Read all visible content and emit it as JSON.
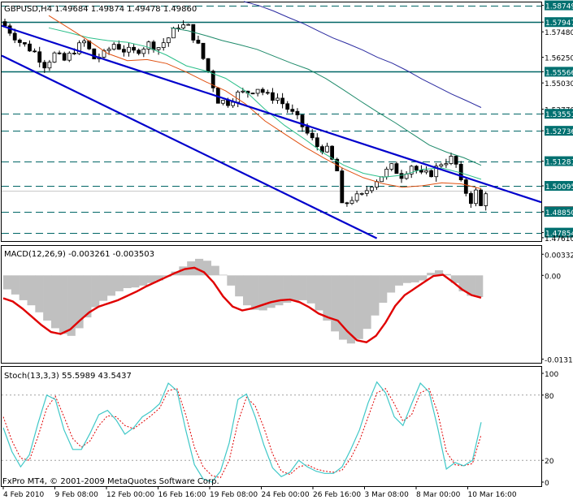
{
  "window": {
    "header": "GBPUSD,H4  1.49684 1.49874 1.49478 1.49860",
    "footer": "FxPro MT4, © 2001-2009 MetaQuotes Software Corp."
  },
  "colors": {
    "bg": "#ffffff",
    "frame": "#000000",
    "bar": "#000000",
    "hline": "#006666",
    "channel": "#0000cc",
    "ma_fast": "#2bbf8a",
    "ma_mid": "#e05010",
    "ma_slow": "#2a2aa0",
    "ma_teal": "#1e8a6a",
    "label_bg": "#007070",
    "label_fg": "#ffffff",
    "macd_hist": "#c0c0c0",
    "macd_signal": "#e00000",
    "stoch_main": "#40c8c8",
    "stoch_signal": "#e00000",
    "hist_grey_line": "#c8c8c8"
  },
  "chart_data": [
    {
      "type": "candlestick",
      "name": "GBPUSD,H4",
      "header_values": {
        "open": 1.49684,
        "high": 1.49874,
        "low": 1.49478,
        "close": 1.4986
      },
      "ylim": [
        1.4745,
        1.5885
      ],
      "y_ticks": [
        1.58749,
        1.57947,
        1.5748,
        1.5626,
        1.55566,
        1.5503,
        1.5377,
        1.53551,
        1.52736,
        1.5128,
        1.50095,
        1.4886,
        1.4885,
        1.47854,
        1.4761
      ],
      "y_tick_labels": [
        "1.58749",
        "1.57947",
        "1.57480",
        "1.56250",
        "1.55566",
        "1.55030",
        "1.53770",
        "1.53551",
        "1.52736",
        "1.51281",
        "1.50095",
        "1.49860",
        "1.48850",
        "1.47854",
        "1.47610"
      ],
      "horizontal_levels": [
        {
          "value": 1.58749,
          "label": "1.58749",
          "style": "dashed"
        },
        {
          "value": 1.57947,
          "label": "1.57947",
          "style": "solid"
        },
        {
          "value": 1.55566,
          "label": "1.55566",
          "style": "solid"
        },
        {
          "value": 1.53551,
          "label": "1.53551",
          "style": "dashed"
        },
        {
          "value": 1.52736,
          "label": "1.52736",
          "style": "dashed"
        },
        {
          "value": 1.51281,
          "label": "1.51281",
          "style": "dashed"
        },
        {
          "value": 1.50095,
          "label": "1.50095",
          "style": "dashed"
        },
        {
          "value": 1.4885,
          "label": "1.48850",
          "style": "dashed"
        },
        {
          "value": 1.47854,
          "label": "1.47854",
          "style": "dashed"
        }
      ],
      "current_price": {
        "value": 1.4986,
        "label": "1.49860"
      },
      "channel_lines": [
        {
          "from": {
            "bar": 0,
            "price": 1.5777
          },
          "to": {
            "bar": 110,
            "price": 1.4931
          }
        },
        {
          "from": {
            "bar": 0,
            "price": 1.5634
          },
          "to": {
            "bar": 76,
            "price": 1.4758
          }
        }
      ],
      "bar_count": 98,
      "last_close": 1.4986,
      "moving_averages": [
        {
          "color_key": "ma_fast",
          "values": [
            1.5767,
            1.5745,
            1.572,
            1.5706,
            1.5698,
            1.5676,
            1.5636,
            1.5585,
            1.556,
            1.5525,
            1.5465,
            1.5376,
            1.5299,
            1.5235,
            1.5166,
            1.5109,
            1.507,
            1.5051,
            1.5061,
            1.5089,
            1.5095,
            1.5071,
            1.5041
          ]
        },
        {
          "color_key": "ma_mid",
          "values": [
            1.5826,
            1.5767,
            1.5707,
            1.5644,
            1.561,
            1.5615,
            1.5596,
            1.5555,
            1.5508,
            1.5465,
            1.5403,
            1.5321,
            1.5258,
            1.5197,
            1.5143,
            1.5092,
            1.5049,
            1.502,
            1.5003,
            1.501,
            1.5024,
            1.5019,
            1.4996
          ]
        },
        {
          "color_key": "ma_teal",
          "values": [
            1.5767,
            1.5753,
            1.5731,
            1.5706,
            1.5686,
            1.5664,
            1.5631,
            1.5598,
            1.5568,
            1.5524,
            1.5471,
            1.5416,
            1.5363,
            1.5313,
            1.5259,
            1.5205,
            1.5171,
            1.5144,
            1.5108
          ]
        },
        {
          "color_key": "ma_slow",
          "values": [
            1.5893,
            1.5874,
            1.5848,
            1.5817,
            1.5788,
            1.5753,
            1.5719,
            1.5691,
            1.5661,
            1.5626,
            1.5598,
            1.5562,
            1.5522,
            1.5486,
            1.545,
            1.5418,
            1.5385
          ]
        }
      ]
    },
    {
      "type": "area",
      "name": "MACD(12,26,9) -0.003261 -0.003503",
      "ylim": [
        -0.0136,
        0.0045
      ],
      "y_ticks": [
        0.00332,
        0.0,
        -0.01315
      ],
      "y_tick_labels": [
        "0.00332",
        "0.00",
        "-0.01315"
      ],
      "series": [
        {
          "name": "MACD",
          "kind": "histogram",
          "values": [
            -0.0022,
            -0.003,
            -0.0039,
            -0.0047,
            -0.0058,
            -0.0071,
            -0.0083,
            -0.0092,
            -0.0095,
            -0.0083,
            -0.0066,
            -0.005,
            -0.004,
            -0.0032,
            -0.0025,
            -0.002,
            -0.0019,
            -0.0016,
            -0.0012,
            -0.0008,
            -0.0002,
            0.0006,
            0.0014,
            0.0022,
            0.0026,
            0.0023,
            0.0015,
            0.0001,
            -0.0016,
            -0.0033,
            -0.0047,
            -0.0054,
            -0.0055,
            -0.0051,
            -0.0047,
            -0.0043,
            -0.004,
            -0.0039,
            -0.0044,
            -0.0055,
            -0.0071,
            -0.0088,
            -0.0101,
            -0.0107,
            -0.01,
            -0.0084,
            -0.0063,
            -0.0043,
            -0.0027,
            -0.0016,
            -0.0012,
            -0.0011,
            -0.0008,
            0.0004,
            0.0008,
            0.0002,
            -0.0012,
            -0.0025,
            -0.0032,
            -0.0034
          ]
        },
        {
          "name": "Signal",
          "kind": "line",
          "values": [
            -0.0036,
            -0.0041,
            -0.0052,
            -0.0065,
            -0.0078,
            -0.0089,
            -0.0092,
            -0.0085,
            -0.0071,
            -0.0058,
            -0.0049,
            -0.0044,
            -0.0039,
            -0.0032,
            -0.0025,
            -0.0017,
            -0.001,
            -0.0003,
            0.0004,
            0.001,
            0.0012,
            0.0005,
            -0.0011,
            -0.0033,
            -0.0049,
            -0.0055,
            -0.0052,
            -0.0047,
            -0.0042,
            -0.0039,
            -0.0038,
            -0.0042,
            -0.005,
            -0.006,
            -0.0066,
            -0.0071,
            -0.0088,
            -0.0102,
            -0.0105,
            -0.0095,
            -0.0074,
            -0.0048,
            -0.0031,
            -0.0021,
            -0.0011,
            -0.0001,
            0.0001,
            -0.001,
            -0.0022,
            -0.0031,
            -0.0035
          ]
        }
      ]
    },
    {
      "type": "line",
      "name": "Stoch(13,3,3) 55.5989 43.5437",
      "ylim": [
        0,
        100
      ],
      "y_ticks": [
        100,
        80,
        20,
        0
      ],
      "y_tick_labels": [
        "100",
        "80",
        "20",
        "0"
      ],
      "series": [
        {
          "name": "Main",
          "values": [
            50,
            28,
            14,
            25,
            54,
            80,
            76,
            48,
            30,
            30,
            45,
            62,
            66,
            57,
            44,
            50,
            60,
            65,
            72,
            91,
            84,
            48,
            16,
            3,
            0,
            10,
            36,
            76,
            81,
            60,
            34,
            13,
            5,
            9,
            20,
            14,
            10,
            8,
            8,
            14,
            30,
            48,
            73,
            92,
            82,
            60,
            52,
            72,
            91,
            83,
            50,
            12,
            18,
            15,
            20,
            55
          ]
        },
        {
          "name": "Signal",
          "values": [
            60,
            38,
            22,
            20,
            42,
            68,
            79,
            60,
            40,
            32,
            38,
            52,
            61,
            60,
            52,
            49,
            55,
            61,
            68,
            84,
            86,
            62,
            32,
            14,
            6,
            4,
            20,
            55,
            78,
            70,
            50,
            26,
            10,
            7,
            14,
            16,
            12,
            10,
            9,
            11,
            22,
            38,
            60,
            82,
            86,
            72,
            56,
            62,
            82,
            86,
            64,
            28,
            16,
            15,
            17,
            43.5
          ]
        }
      ]
    }
  ],
  "time_axis": {
    "labels": [
      "4 Feb 2010",
      "9 Feb 08:00",
      "12 Feb 00:00",
      "16 Feb 16:00",
      "19 Feb 08:00",
      "24 Feb 00:00",
      "26 Feb 16:00",
      "3 Mar 08:00",
      "8 Mar 00:00",
      "10 Mar 16:00"
    ]
  }
}
